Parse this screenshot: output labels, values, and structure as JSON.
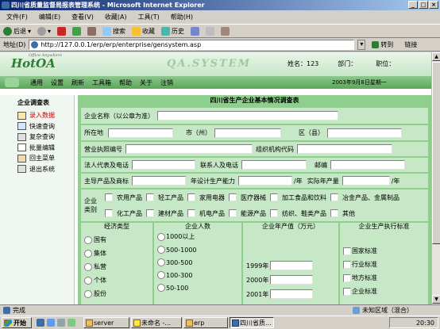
{
  "window": {
    "title": "四川省质量监督局报表管理系统 - Microsoft Internet Explorer"
  },
  "menubar": [
    "文件(F)",
    "编辑(E)",
    "查看(V)",
    "收藏(A)",
    "工具(T)",
    "帮助(H)"
  ],
  "toolbar": {
    "back": "后退",
    "search": "搜索",
    "favorites": "收藏",
    "history": "历史"
  },
  "address": {
    "label": "地址(D)",
    "url": "http://127.0.0.1/erp/erp/enterprise/gensystem.asp",
    "go": "转到",
    "links": "链接"
  },
  "app": {
    "logo": "HotOA",
    "logo_tagline": "Office Anywhere",
    "brand": "QA.SYSTEM",
    "user": {
      "name_label": "姓名：123",
      "dept_label": "部门：",
      "title_label": "职位："
    },
    "nav": [
      "通用",
      "设置",
      "刷新",
      "工具箱",
      "帮助",
      "关于",
      "注销"
    ],
    "date": "2003年9月8日星期一"
  },
  "sidebar": {
    "title": "企业调查表",
    "items": [
      "录入数据",
      "快速查询",
      "复杂查询",
      "批量编辑",
      "回主菜单",
      "退出系统"
    ]
  },
  "form": {
    "title": "四川省生产企业基本情况调查表",
    "company_name": "企业名称（以公章为准）",
    "location": "所在地",
    "city": "市（州）",
    "county": "区（县）",
    "license": "营业执照编号",
    "org_code": "组织机构代码",
    "legal_rep": "法人代表及电话",
    "contact": "联系人及电话",
    "postcode": "邮编",
    "main_product": "主导产品及商标",
    "annual_capacity": "年设计生产能力",
    "unit_year": "/年",
    "actual_output": "实际年产量",
    "category_label": [
      "企业",
      "类别"
    ],
    "categories_row1": [
      "农用产品",
      "轻工产品",
      "家用电器",
      "医疗器械",
      "加工食品和饮料",
      "冶金产品、金属制品"
    ],
    "categories_row2": [
      "化工产品",
      "建材产品",
      "机电产品",
      "能源产品",
      "纺织、鞋类产品",
      "其他"
    ],
    "sub_headers": [
      "经济类型",
      "企业人数",
      "企业年产值（万元）",
      "企业生产执行标准"
    ],
    "econ_types": [
      "国有",
      "集体",
      "私营",
      "个体",
      "股份"
    ],
    "headcount": [
      "1000以上",
      "500-1000",
      "300-500",
      "100-300",
      "50-100"
    ],
    "years": [
      "1999年",
      "2000年",
      "2001年"
    ],
    "standards": [
      "国家标准",
      "行业标准",
      "地方标准",
      "企业标准"
    ]
  },
  "statusbar": {
    "text": "完成",
    "zone": "未知区域（混合）"
  },
  "taskbar": {
    "start": "开始",
    "tasks": [
      "server",
      "未命名 -...",
      "erp",
      "四川省质..."
    ],
    "clock": "20:30"
  }
}
